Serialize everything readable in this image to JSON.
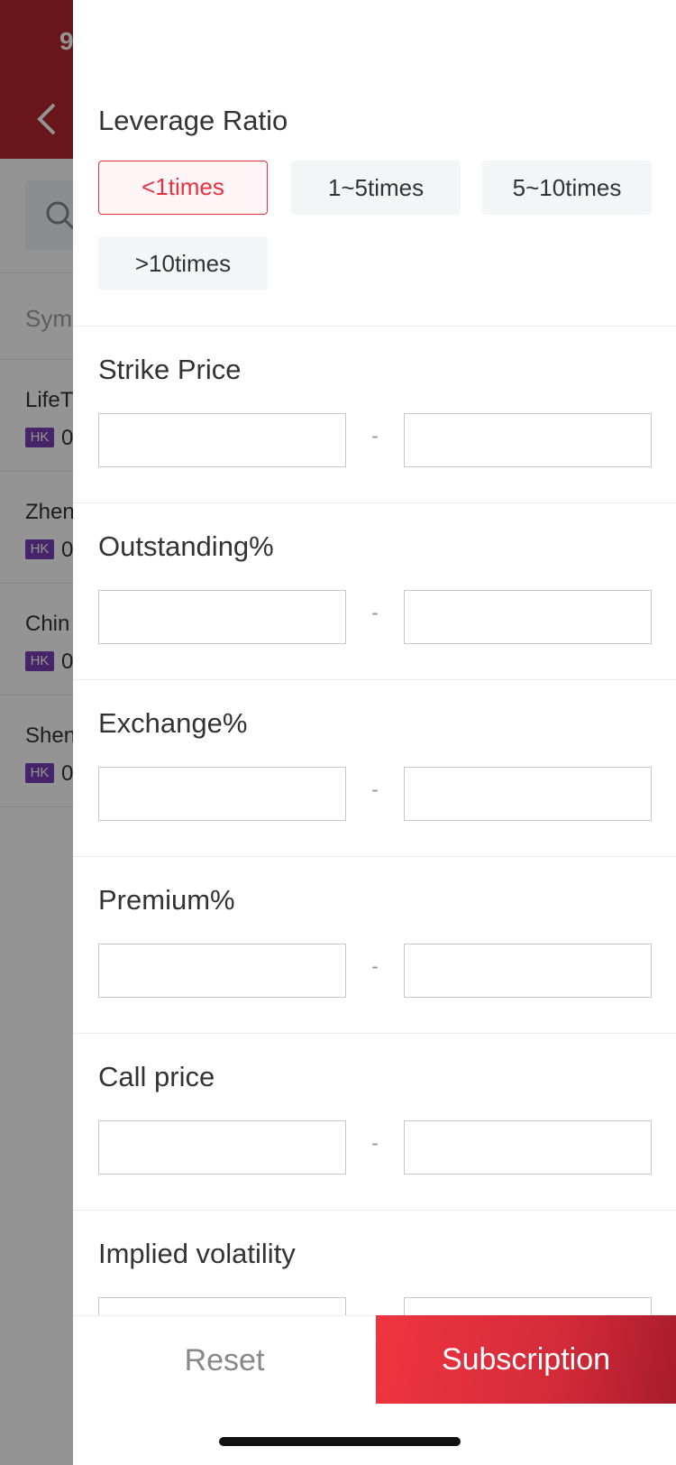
{
  "background": {
    "status_time": "9",
    "column_header": "Sym",
    "rows": [
      {
        "name": "LifeT",
        "market": "HK",
        "code": "0"
      },
      {
        "name": "Zhen",
        "market": "HK",
        "code": "0"
      },
      {
        "name": "Chin",
        "market": "HK",
        "code": "0"
      },
      {
        "name": "Shen",
        "market": "HK",
        "code": "0"
      }
    ]
  },
  "filters": {
    "leverage": {
      "title": "Leverage Ratio",
      "options": [
        "<1times",
        "1~5times",
        "5~10times",
        ">10times"
      ],
      "selected": "<1times"
    },
    "ranges": [
      {
        "title": "Strike Price",
        "min": "",
        "max": "",
        "separator": "-"
      },
      {
        "title": "Outstanding%",
        "min": "",
        "max": "",
        "separator": "-"
      },
      {
        "title": "Exchange%",
        "min": "",
        "max": "",
        "separator": "-"
      },
      {
        "title": "Premium%",
        "min": "",
        "max": "",
        "separator": "-"
      },
      {
        "title": "Call price",
        "min": "",
        "max": "",
        "separator": "-"
      },
      {
        "title": "Implied volatility",
        "min": "",
        "max": "",
        "separator": "-"
      }
    ]
  },
  "footer": {
    "reset_label": "Reset",
    "submit_label": "Subscription"
  },
  "colors": {
    "accent": "#e8323f",
    "header_red": "#b3252f",
    "badge_purple": "#7a3fb5"
  }
}
